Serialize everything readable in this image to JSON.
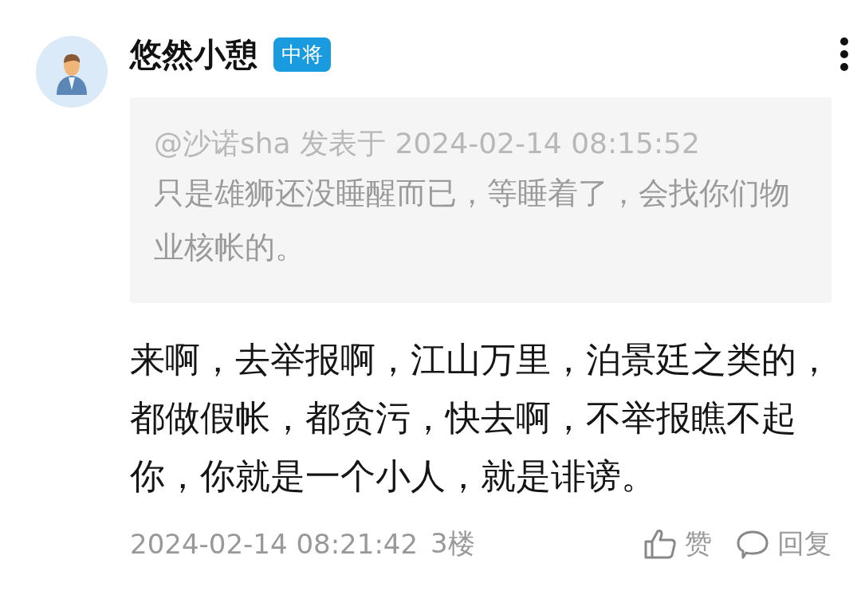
{
  "post": {
    "author": "悠然小憩",
    "badge": "中将",
    "quote": {
      "header": "@沙诺sha 发表于 2024-02-14 08:15:52",
      "text": "只是雄狮还没睡醒而已，等睡着了，会找你们物业核帐的。"
    },
    "text": "来啊，去举报啊，江山万里，泊景廷之类的，都做假帐，都贪污，快去啊，不举报瞧不起你，你就是一个小人，就是诽谤。",
    "time": "2024-02-14 08:21:42",
    "floor": "3楼",
    "like": "赞",
    "reply": "回复"
  }
}
